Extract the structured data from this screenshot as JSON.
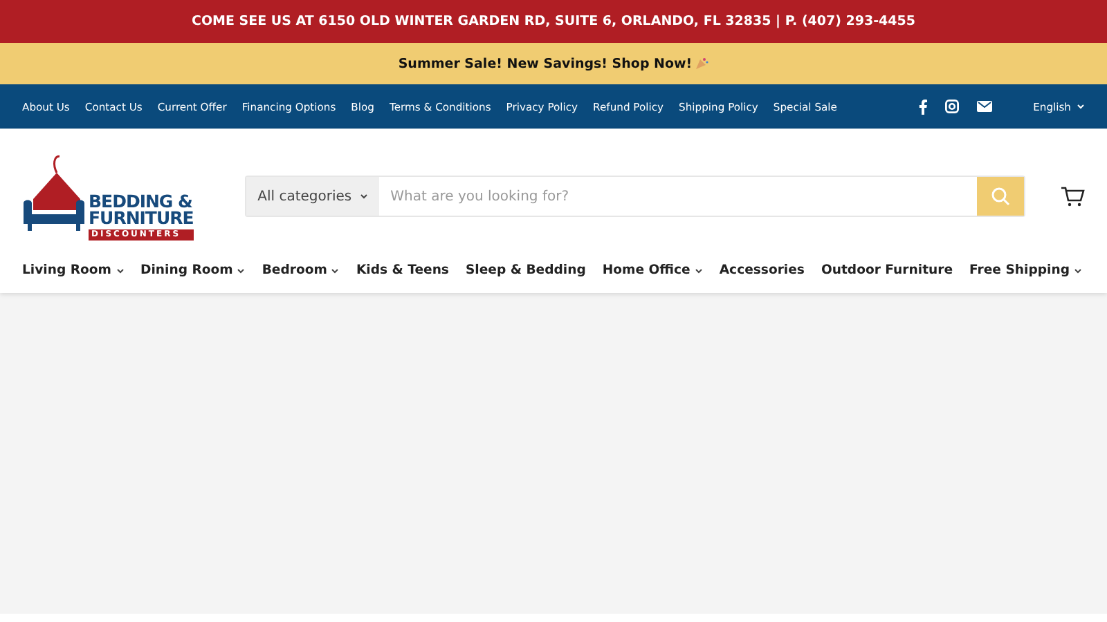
{
  "announcement": "COME SEE US AT 6150 OLD WINTER GARDEN RD, SUITE 6, ORLANDO, FL 32835 | P. (407) 293-4455",
  "promo": "Summer Sale! New Savings! Shop Now!",
  "utility_links": [
    "About Us",
    "Contact Us",
    "Current Offer",
    "Financing Options",
    "Blog",
    "Terms & Conditions",
    "Privacy Policy",
    "Refund Policy",
    "Shipping Policy",
    "Special Sale"
  ],
  "language": "English",
  "logo": {
    "line_1": "BEDDING &",
    "line_2": "FURNITURE",
    "line_3": "DISCOUNTERS"
  },
  "search": {
    "category": "All categories",
    "placeholder": "What are you looking for?"
  },
  "main_nav": [
    {
      "label": "Living Room",
      "has_dropdown": true
    },
    {
      "label": "Dining Room",
      "has_dropdown": true
    },
    {
      "label": "Bedroom",
      "has_dropdown": true
    },
    {
      "label": "Kids & Teens",
      "has_dropdown": false
    },
    {
      "label": "Sleep & Bedding",
      "has_dropdown": false
    },
    {
      "label": "Home Office",
      "has_dropdown": true
    },
    {
      "label": "Accessories",
      "has_dropdown": false
    },
    {
      "label": "Outdoor Furniture",
      "has_dropdown": false
    },
    {
      "label": "Free Shipping",
      "has_dropdown": true
    }
  ]
}
